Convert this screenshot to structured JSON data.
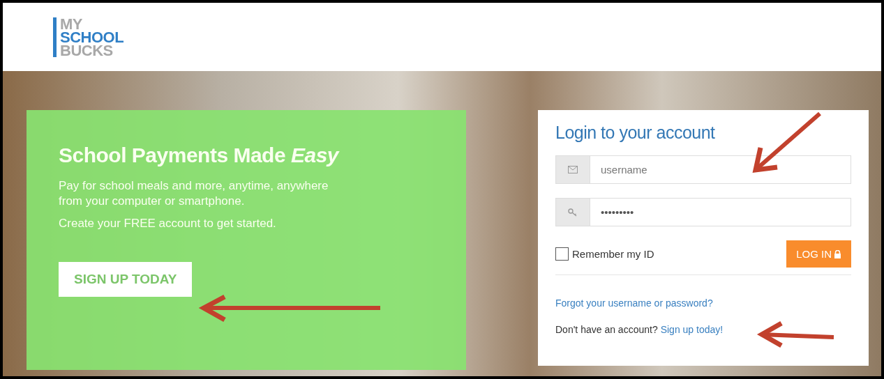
{
  "logo": {
    "lines": [
      "MY",
      "SCHOOL",
      "BUCKS"
    ]
  },
  "hero": {
    "headline": "School Payments Made *Easy*",
    "paragraphs": [
      "Pay for school meals and more, anytime, anywhere from your computer or smartphone.",
      "Create your FREE account to get started."
    ],
    "cta": "SIGN UP TODAY"
  },
  "login": {
    "title": "Login to your account",
    "username": {
      "placeholder": "username"
    },
    "password": {
      "value": "•••••••••"
    },
    "remember": {
      "label": "Remember my ID",
      "checked": false
    },
    "submit": "LOG IN",
    "forgot_link": "Forgot your username or password?",
    "signup_prompt": "Don't have an account?",
    "signup_link": "Sign up today!"
  }
}
